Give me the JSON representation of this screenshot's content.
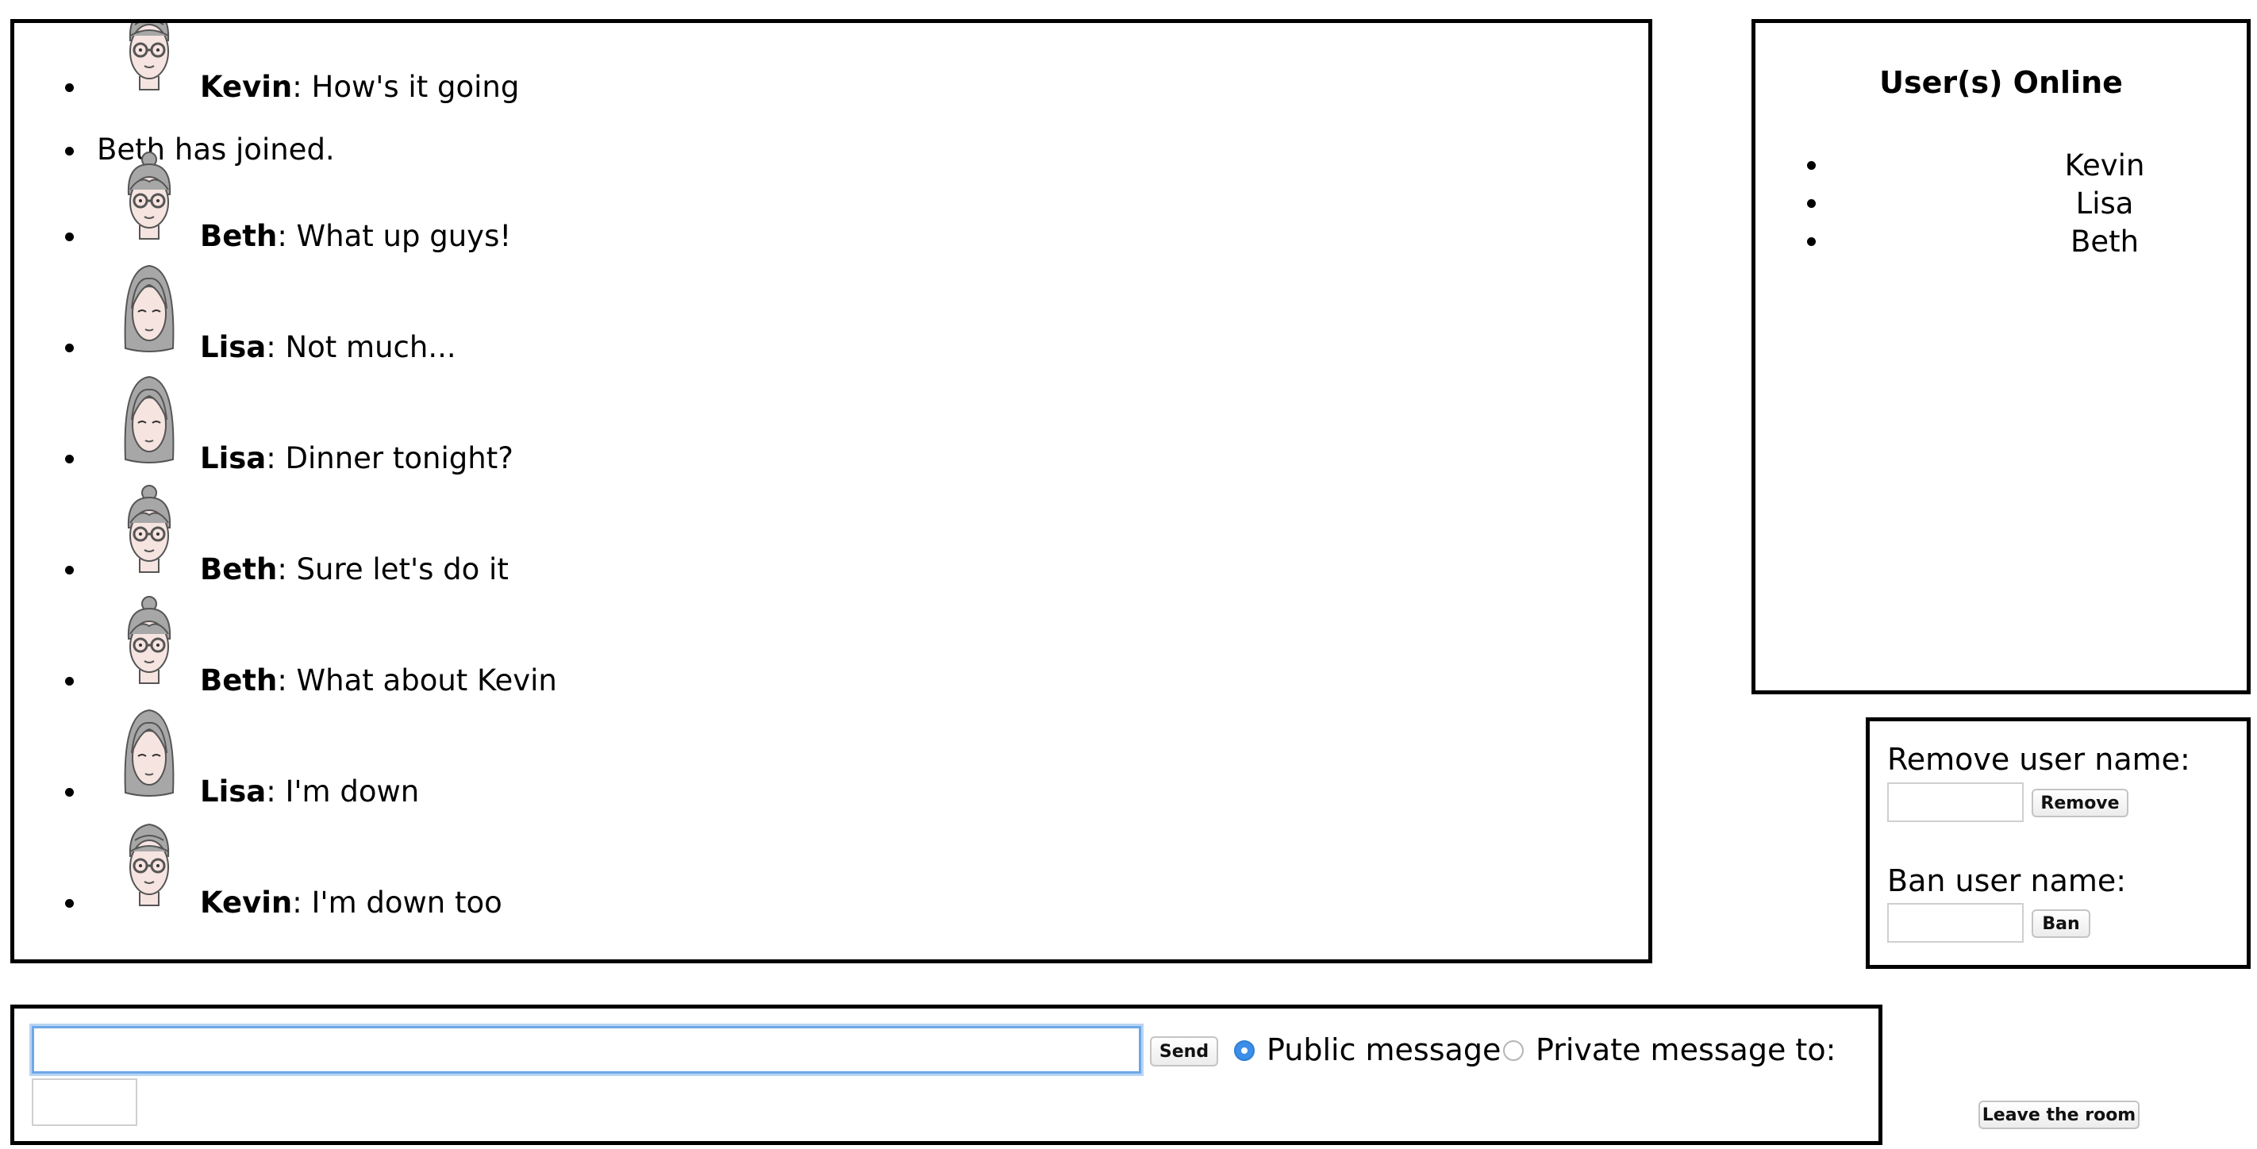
{
  "chat": {
    "messages": [
      {
        "type": "message",
        "sender": "Kevin",
        "text": ": How's it going",
        "avatar": "kevin-avatar-icon"
      },
      {
        "type": "system",
        "text": "Beth has joined."
      },
      {
        "type": "message",
        "sender": "Beth",
        "text": ": What up guys!",
        "avatar": "beth-avatar-icon"
      },
      {
        "type": "message",
        "sender": "Lisa",
        "text": ": Not much...",
        "avatar": "lisa-avatar-icon"
      },
      {
        "type": "message",
        "sender": "Lisa",
        "text": ": Dinner tonight?",
        "avatar": "lisa-avatar-icon"
      },
      {
        "type": "message",
        "sender": "Beth",
        "text": ": Sure let's do it",
        "avatar": "beth-avatar-icon"
      },
      {
        "type": "message",
        "sender": "Beth",
        "text": ": What about Kevin",
        "avatar": "beth-avatar-icon"
      },
      {
        "type": "message",
        "sender": "Lisa",
        "text": ": I'm down",
        "avatar": "lisa-avatar-icon"
      },
      {
        "type": "message",
        "sender": "Kevin",
        "text": ": I'm down too",
        "avatar": "kevin-avatar-icon"
      }
    ]
  },
  "online": {
    "title": "User(s) Online",
    "users": [
      "Kevin",
      "Lisa",
      "Beth"
    ]
  },
  "admin": {
    "remove_label": "Remove user name:",
    "remove_value": "",
    "remove_button": "Remove",
    "ban_label": "Ban user name:",
    "ban_value": "",
    "ban_button": "Ban"
  },
  "compose": {
    "message_value": "",
    "send_button": "Send",
    "public_label": "Public message",
    "public_selected": true,
    "private_label": "Private message to:",
    "private_selected": false,
    "recipient_value": ""
  },
  "leave_button": "Leave the room",
  "colors": {
    "border": "#000000",
    "focus_ring": "#6ea8e6",
    "radio_selected": "#3b8fe8"
  }
}
